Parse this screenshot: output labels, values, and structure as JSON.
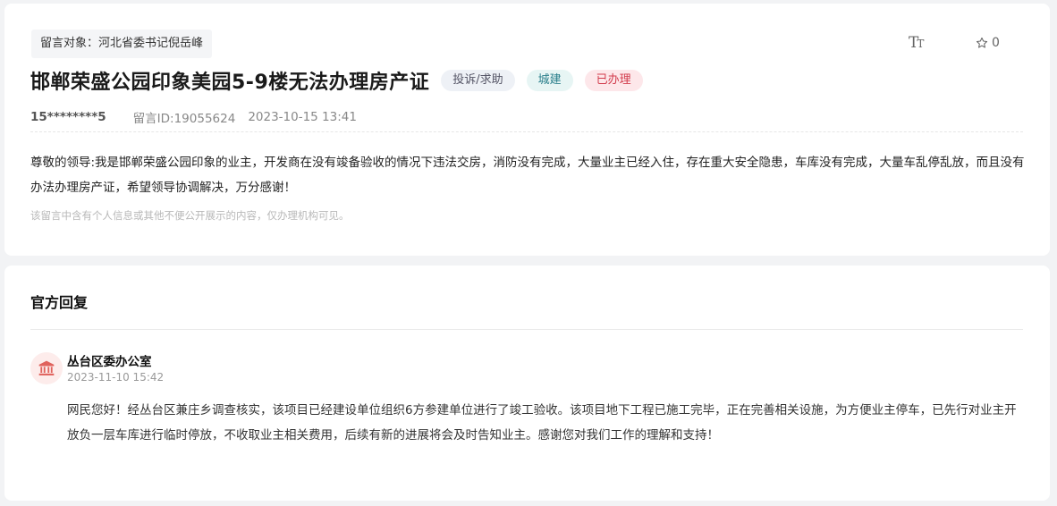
{
  "message": {
    "target": "留言对象：河北省委书记倪岳峰",
    "font_toggle_icon": "text-size-icon",
    "favorite_icon": "star-outline-icon",
    "favorite_count": "0",
    "title": "邯郸荣盛公园印象美园5-9楼无法办理房产证",
    "tags": {
      "type": "投诉/求助",
      "category": "城建",
      "status": "已办理"
    },
    "user": "15********5",
    "message_id": "留言ID:19055624",
    "datetime": "2023-10-15 13:41",
    "body": "尊敬的领导:我是邯郸荣盛公园印象的业主，开发商在没有竣备验收的情况下违法交房，消防没有完成，大量业主已经入住，存在重大安全隐患，车库没有完成，大量车乱停乱放，而且没有办法办理房产证，希望领导协调解决，万分感谢！",
    "privacy_note": "该留言中含有个人信息或其他不便公开展示的内容，仅办理机构可见。"
  },
  "reply": {
    "heading": "官方回复",
    "avatar_icon": "government-building-icon",
    "org": "丛台区委办公室",
    "datetime": "2023-11-10 15:42",
    "body": "网民您好！经丛台区兼庄乡调查核实，该项目已经建设单位组织6方参建单位进行了竣工验收。该项目地下工程已施工完毕，正在完善相关设施，为方便业主停车，已先行对业主开放负一层车库进行临时停放，不收取业主相关费用，后续有新的进展将会及时告知业主。感谢您对我们工作的理解和支持！"
  },
  "colors": {
    "badge_status": "#d23b4c",
    "badge_category": "#2a7f8b",
    "avatar_icon": "#e0625c"
  }
}
